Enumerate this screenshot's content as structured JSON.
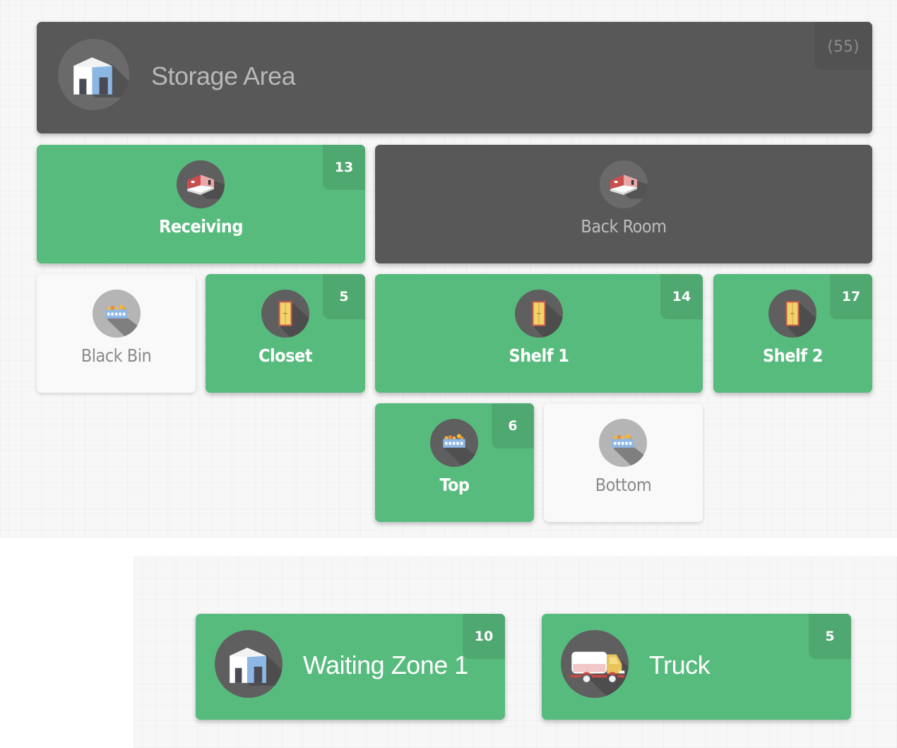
{
  "colors": {
    "active": "#58bb7e",
    "active_badge": "#50a871",
    "parent": "#585858",
    "empty": "#f9f9f9"
  },
  "storage_area": {
    "label": "Storage Area",
    "count": "(55)",
    "icon": "warehouse-icon"
  },
  "locations": [
    {
      "id": "receiving",
      "label": "Receiving",
      "count": "13",
      "state": "active",
      "icon": "room-icon"
    },
    {
      "id": "back-room",
      "label": "Back Room",
      "count": "",
      "state": "parent",
      "icon": "room-icon"
    },
    {
      "id": "black-bin",
      "label": "Black Bin",
      "count": "",
      "state": "empty",
      "icon": "bin-icon"
    },
    {
      "id": "closet",
      "label": "Closet",
      "count": "5",
      "state": "active",
      "icon": "cabinet-icon"
    },
    {
      "id": "shelf-1",
      "label": "Shelf 1",
      "count": "14",
      "state": "active",
      "icon": "cabinet-icon"
    },
    {
      "id": "shelf-2",
      "label": "Shelf 2",
      "count": "17",
      "state": "active",
      "icon": "cabinet-icon"
    },
    {
      "id": "top",
      "label": "Top",
      "count": "6",
      "state": "active",
      "icon": "bin-icon"
    },
    {
      "id": "bottom",
      "label": "Bottom",
      "count": "",
      "state": "empty",
      "icon": "bin-icon"
    }
  ],
  "zones": [
    {
      "id": "waiting-zone-1",
      "label": "Waiting Zone 1",
      "count": "10",
      "icon": "warehouse-icon"
    },
    {
      "id": "truck",
      "label": "Truck",
      "count": "5",
      "icon": "truck-icon"
    }
  ]
}
